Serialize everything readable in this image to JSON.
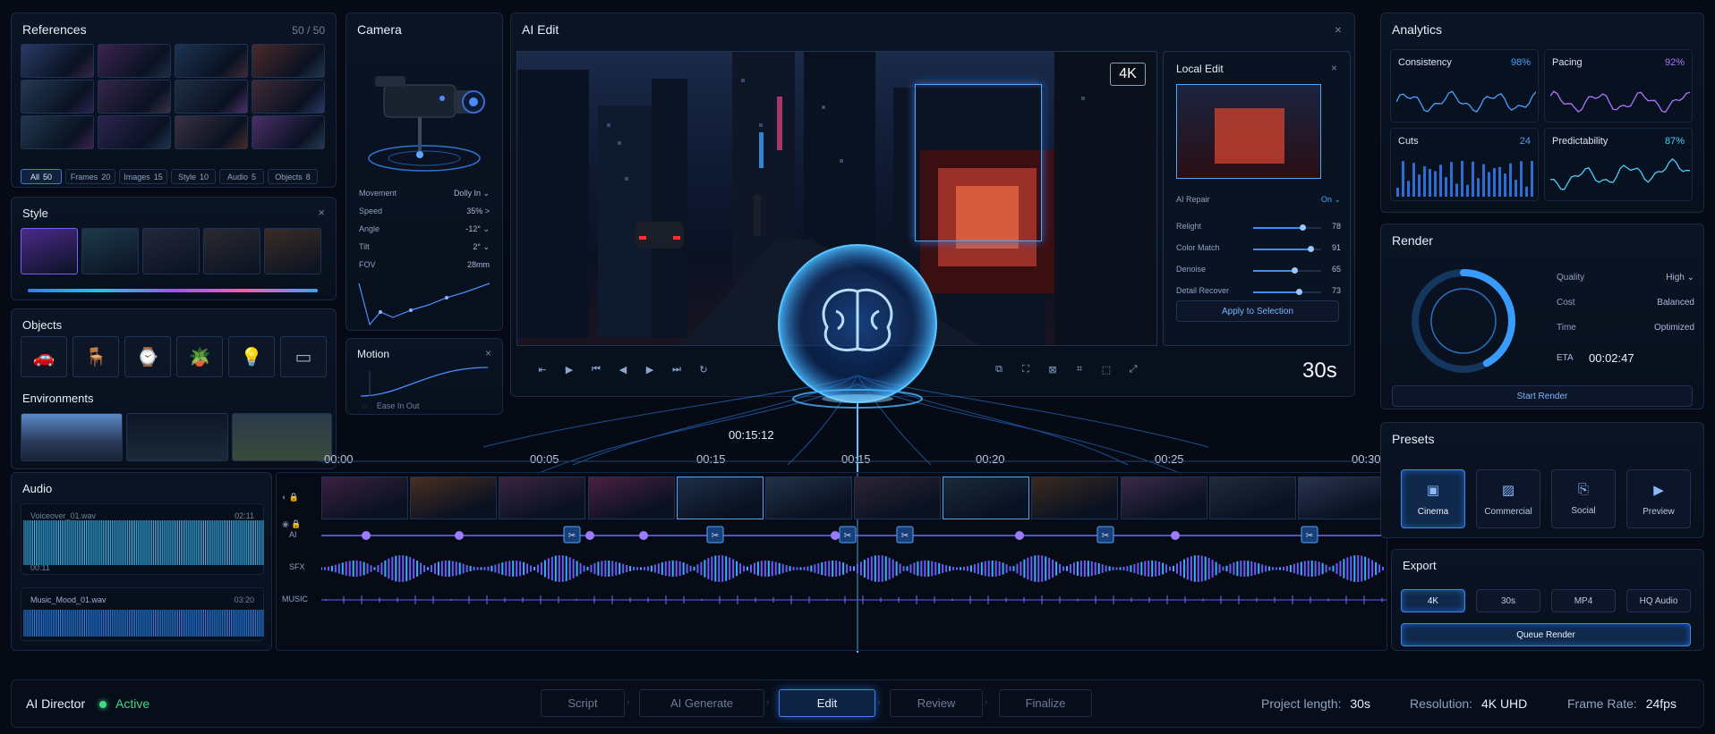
{
  "references": {
    "title": "References",
    "count": "50 / 50",
    "filters": [
      {
        "label": "All",
        "count": "50"
      },
      {
        "label": "Frames",
        "count": "20"
      },
      {
        "label": "Images",
        "count": "15"
      },
      {
        "label": "Style",
        "count": "10"
      },
      {
        "label": "Audio",
        "count": "5"
      },
      {
        "label": "Objects",
        "count": "8"
      }
    ]
  },
  "style": {
    "title": "Style",
    "close": "×"
  },
  "objects": {
    "title": "Objects"
  },
  "environments": {
    "title": "Environments"
  },
  "audio": {
    "title": "Audio",
    "tracks": [
      {
        "name": "Voiceover_01.wav",
        "duration": "02:11",
        "pos": "00:11"
      },
      {
        "name": "Music_Mood_01.wav",
        "duration": "03:20"
      }
    ]
  },
  "camera": {
    "title": "Camera",
    "rows": [
      {
        "label": "Movement",
        "value": "Dolly In ⌄"
      },
      {
        "label": "Speed",
        "value": "35% >"
      },
      {
        "label": "Angle",
        "value": "-12° ⌄"
      },
      {
        "label": "Tilt",
        "value": "2° ⌄"
      },
      {
        "label": "FOV",
        "value": "28mm"
      }
    ]
  },
  "motion": {
    "title": "Motion",
    "ease": "Ease In Out",
    "close": "×"
  },
  "ai_edit": {
    "title": "AI Edit",
    "close": "×",
    "badge": "4K",
    "duration": "30s",
    "playhead": "00:15:12"
  },
  "local_edit": {
    "title": "Local Edit",
    "close": "×",
    "ai_repair_label": "AI Repair",
    "ai_repair_value": "On ⌄",
    "sliders": [
      {
        "label": "Relight",
        "value": "78",
        "level": 0.78
      },
      {
        "label": "Color Match",
        "value": "91",
        "level": 0.91
      },
      {
        "label": "Denoise",
        "value": "65",
        "level": 0.65
      },
      {
        "label": "Detail Recover",
        "value": "73",
        "level": 0.73
      }
    ],
    "apply": "Apply to Selection"
  },
  "timeline": {
    "ticks": [
      "00:00",
      "00:05",
      "00:15",
      "00:15",
      "00:20",
      "00:25",
      "00:30"
    ],
    "tracks": [
      "AI",
      "SFX",
      "MUSIC"
    ]
  },
  "analytics": {
    "title": "Analytics",
    "metrics": [
      {
        "label": "Consistency",
        "value": "98%",
        "color": "#4aa3ff"
      },
      {
        "label": "Pacing",
        "value": "92%",
        "color": "#b072ff"
      },
      {
        "label": "Cuts",
        "value": "24",
        "color": "#4aa3ff"
      },
      {
        "label": "Predictability",
        "value": "87%",
        "color": "#4ad0ff"
      }
    ]
  },
  "render": {
    "title": "Render",
    "progress": 0.42,
    "rows": [
      {
        "label": "Quality",
        "value": "High ⌄"
      },
      {
        "label": "Cost",
        "value": "Balanced"
      },
      {
        "label": "Time",
        "value": "Optimized"
      }
    ],
    "eta_label": "ETA",
    "eta_value": "00:02:47",
    "start": "Start Render"
  },
  "presets": {
    "title": "Presets",
    "items": [
      "Cinema",
      "Commercial",
      "Social",
      "Preview"
    ]
  },
  "export": {
    "title": "Export",
    "options": [
      "4K",
      "30s",
      "MP4",
      "HQ Audio"
    ],
    "queue": "Queue Render"
  },
  "footer": {
    "director": "AI Director",
    "status": "Active",
    "steps": [
      "Script",
      "AI Generate",
      "Edit",
      "Review",
      "Finalize"
    ],
    "project_label": "Project length:",
    "project_value": "30s",
    "res_label": "Resolution:",
    "res_value": "4K UHD",
    "fps_label": "Frame Rate:",
    "fps_value": "24fps"
  },
  "colors": {
    "accent": "#3f86f0",
    "active": "#3ddc84",
    "glow": "#48b8ff"
  }
}
